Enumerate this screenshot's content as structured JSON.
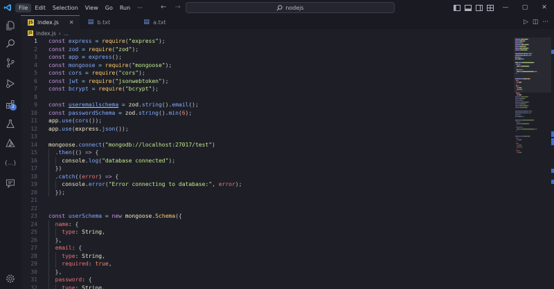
{
  "titlebar": {
    "menu": [
      "File",
      "Edit",
      "Selection",
      "View",
      "Go",
      "Run",
      "···"
    ],
    "active_menu": 0,
    "search_text": "nodejs",
    "window_buttons": [
      "—",
      "▢",
      "✕"
    ]
  },
  "tabs": [
    {
      "label": "index.js",
      "type": "js",
      "active": true
    },
    {
      "label": "b.txt",
      "type": "txt",
      "active": false
    },
    {
      "label": "a.txt",
      "type": "txt",
      "active": false
    }
  ],
  "breadcrumb": {
    "file": "index.js",
    "trail": "..."
  },
  "activity": {
    "extensions_badge": "2"
  },
  "editor": {
    "current_line": 1,
    "lines": [
      {
        "n": "1",
        "t": [
          [
            "kw",
            "const "
          ],
          [
            "var",
            "express"
          ],
          [
            "op",
            " = "
          ],
          [
            "fnb",
            "require"
          ],
          [
            "punc",
            "("
          ],
          [
            "str",
            "\"express\""
          ],
          [
            "punc",
            ");"
          ]
        ]
      },
      {
        "n": "2",
        "t": [
          [
            "kw",
            "const "
          ],
          [
            "var",
            "zod"
          ],
          [
            "op",
            " = "
          ],
          [
            "fnb",
            "require"
          ],
          [
            "punc",
            "("
          ],
          [
            "str",
            "\"zod\""
          ],
          [
            "punc",
            ");"
          ]
        ]
      },
      {
        "n": "3",
        "t": [
          [
            "kw",
            "const "
          ],
          [
            "var",
            "app"
          ],
          [
            "op",
            " = "
          ],
          [
            "fn",
            "express"
          ],
          [
            "punc",
            "();"
          ]
        ]
      },
      {
        "n": "4",
        "t": [
          [
            "kw",
            "const "
          ],
          [
            "var",
            "mongoose"
          ],
          [
            "op",
            " = "
          ],
          [
            "fnb",
            "require"
          ],
          [
            "punc",
            "("
          ],
          [
            "str",
            "\"mongoose\""
          ],
          [
            "punc",
            ");"
          ]
        ]
      },
      {
        "n": "5",
        "t": [
          [
            "kw",
            "const "
          ],
          [
            "var",
            "cors"
          ],
          [
            "op",
            " = "
          ],
          [
            "fnb",
            "require"
          ],
          [
            "punc",
            "("
          ],
          [
            "str",
            "\"cors\""
          ],
          [
            "punc",
            ");"
          ]
        ]
      },
      {
        "n": "6",
        "t": [
          [
            "kw",
            "const "
          ],
          [
            "var",
            "jwt"
          ],
          [
            "op",
            " = "
          ],
          [
            "fnb",
            "require"
          ],
          [
            "punc",
            "("
          ],
          [
            "str",
            "\"jsonwebtoken\""
          ],
          [
            "punc",
            ");"
          ]
        ]
      },
      {
        "n": "7",
        "t": [
          [
            "kw",
            "const "
          ],
          [
            "var",
            "bcrypt"
          ],
          [
            "op",
            " = "
          ],
          [
            "fnb",
            "require"
          ],
          [
            "punc",
            "("
          ],
          [
            "str",
            "\"bcrypt\""
          ],
          [
            "punc",
            ");"
          ]
        ]
      },
      {
        "n": "8",
        "t": []
      },
      {
        "n": "9",
        "t": [
          [
            "kw",
            "const "
          ],
          [
            "var und",
            "useremailschema"
          ],
          [
            "op",
            " = "
          ],
          [
            "obj",
            "zod"
          ],
          [
            "punc",
            "."
          ],
          [
            "fn",
            "string"
          ],
          [
            "punc",
            "()."
          ],
          [
            "fn",
            "email"
          ],
          [
            "punc",
            "();"
          ]
        ]
      },
      {
        "n": "10",
        "t": [
          [
            "kw",
            "const "
          ],
          [
            "var",
            "passwordSchema"
          ],
          [
            "op",
            " = "
          ],
          [
            "obj",
            "zod"
          ],
          [
            "punc",
            "."
          ],
          [
            "fn",
            "string"
          ],
          [
            "punc",
            "()."
          ],
          [
            "fn",
            "min"
          ],
          [
            "punc",
            "("
          ],
          [
            "num",
            "6"
          ],
          [
            "punc",
            ");"
          ]
        ]
      },
      {
        "n": "11",
        "t": [
          [
            "obj",
            "app"
          ],
          [
            "punc",
            "."
          ],
          [
            "fn",
            "use"
          ],
          [
            "punc",
            "("
          ],
          [
            "fn",
            "cors"
          ],
          [
            "punc",
            "());"
          ]
        ]
      },
      {
        "n": "12",
        "t": [
          [
            "obj",
            "app"
          ],
          [
            "punc",
            "."
          ],
          [
            "fn",
            "use"
          ],
          [
            "punc",
            "("
          ],
          [
            "obj",
            "express"
          ],
          [
            "punc",
            "."
          ],
          [
            "fn",
            "json"
          ],
          [
            "punc",
            "());"
          ]
        ]
      },
      {
        "n": "13",
        "t": []
      },
      {
        "n": "14",
        "t": [
          [
            "obj",
            "mongoose"
          ],
          [
            "punc",
            "."
          ],
          [
            "fn",
            "connect"
          ],
          [
            "punc",
            "("
          ],
          [
            "str",
            "\"mongodb://localhost:27017/test\""
          ],
          [
            "punc",
            ")"
          ]
        ]
      },
      {
        "n": "15",
        "t": [
          [
            "punc",
            "  ."
          ],
          [
            "fn",
            "then"
          ],
          [
            "punc",
            "(() "
          ],
          [
            "kw",
            "=>"
          ],
          [
            "punc",
            " {"
          ]
        ]
      },
      {
        "n": "16",
        "t": [
          [
            "punc",
            "    "
          ],
          [
            "obj",
            "console"
          ],
          [
            "punc",
            "."
          ],
          [
            "fn",
            "log"
          ],
          [
            "punc",
            "("
          ],
          [
            "str",
            "\"database connected\""
          ],
          [
            "punc",
            ");"
          ]
        ]
      },
      {
        "n": "17",
        "t": [
          [
            "punc",
            "  })"
          ]
        ]
      },
      {
        "n": "18",
        "t": [
          [
            "punc",
            "  ."
          ],
          [
            "fn",
            "catch"
          ],
          [
            "punc",
            "(("
          ],
          [
            "prop",
            "error"
          ],
          [
            "punc",
            ") "
          ],
          [
            "kw",
            "=>"
          ],
          [
            "punc",
            " {"
          ]
        ]
      },
      {
        "n": "19",
        "t": [
          [
            "punc",
            "    "
          ],
          [
            "obj",
            "console"
          ],
          [
            "punc",
            "."
          ],
          [
            "fn",
            "error"
          ],
          [
            "punc",
            "("
          ],
          [
            "str",
            "\"Error connecting to database:\""
          ],
          [
            "punc",
            ", "
          ],
          [
            "prop",
            "error"
          ],
          [
            "punc",
            ");"
          ]
        ]
      },
      {
        "n": "20",
        "t": [
          [
            "punc",
            "  });"
          ]
        ]
      },
      {
        "n": "21",
        "t": []
      },
      {
        "n": "22",
        "t": []
      },
      {
        "n": "23",
        "t": [
          [
            "kw",
            "const "
          ],
          [
            "var",
            "userSchema"
          ],
          [
            "op",
            " = "
          ],
          [
            "kw",
            "new "
          ],
          [
            "obj",
            "mongoose"
          ],
          [
            "punc",
            "."
          ],
          [
            "fnb",
            "Schema"
          ],
          [
            "punc",
            "({"
          ]
        ]
      },
      {
        "n": "24",
        "t": [
          [
            "punc",
            "  "
          ],
          [
            "prop",
            "name"
          ],
          [
            "punc",
            ": {"
          ]
        ]
      },
      {
        "n": "25",
        "t": [
          [
            "punc",
            "    "
          ],
          [
            "prop",
            "type"
          ],
          [
            "punc",
            ": "
          ],
          [
            "obj",
            "String"
          ],
          [
            "punc",
            ","
          ]
        ]
      },
      {
        "n": "26",
        "t": [
          [
            "punc",
            "  },"
          ]
        ]
      },
      {
        "n": "27",
        "t": [
          [
            "punc",
            "  "
          ],
          [
            "prop",
            "email"
          ],
          [
            "punc",
            ": {"
          ]
        ]
      },
      {
        "n": "28",
        "t": [
          [
            "punc",
            "    "
          ],
          [
            "prop",
            "type"
          ],
          [
            "punc",
            ": "
          ],
          [
            "obj",
            "String"
          ],
          [
            "punc",
            ","
          ]
        ]
      },
      {
        "n": "29",
        "t": [
          [
            "punc",
            "    "
          ],
          [
            "prop",
            "required"
          ],
          [
            "punc",
            ": "
          ],
          [
            "num",
            "true"
          ],
          [
            "punc",
            ","
          ]
        ]
      },
      {
        "n": "30",
        "t": [
          [
            "punc",
            "  },"
          ]
        ]
      },
      {
        "n": "31",
        "t": [
          [
            "punc",
            "  "
          ],
          [
            "prop",
            "password"
          ],
          [
            "punc",
            ": {"
          ]
        ]
      },
      {
        "n": "32",
        "t": [
          [
            "punc",
            "    "
          ],
          [
            "prop",
            "type"
          ],
          [
            "punc",
            ": "
          ],
          [
            "obj",
            "String"
          ],
          [
            "punc",
            ","
          ]
        ]
      }
    ]
  }
}
